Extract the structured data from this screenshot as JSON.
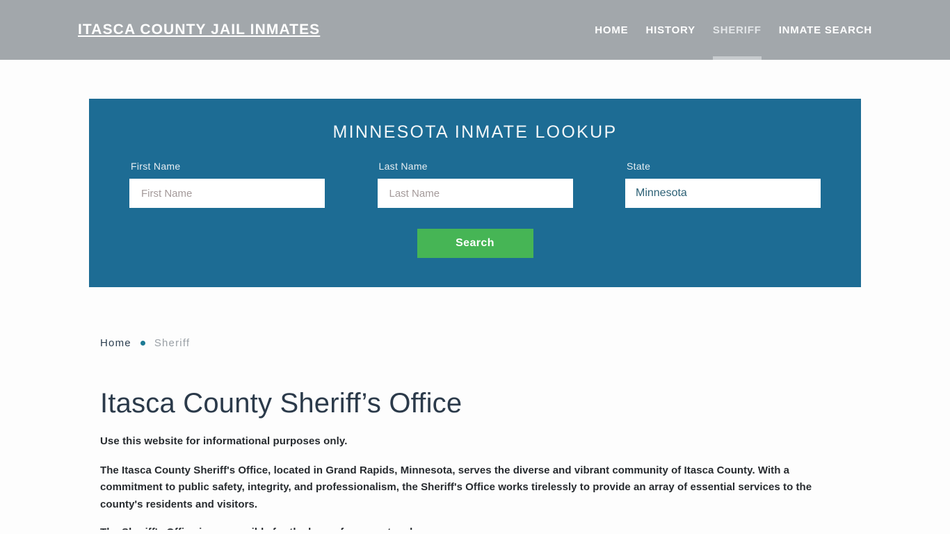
{
  "header": {
    "brand": "ITASCA COUNTY JAIL INMATES",
    "nav": [
      {
        "label": "HOME",
        "active": false
      },
      {
        "label": "HISTORY",
        "active": false
      },
      {
        "label": "SHERIFF",
        "active": true
      },
      {
        "label": "INMATE SEARCH",
        "active": false
      }
    ]
  },
  "lookup": {
    "title": "MINNESOTA INMATE LOOKUP",
    "first_name": {
      "label": "First Name",
      "placeholder": "First Name",
      "value": ""
    },
    "last_name": {
      "label": "Last Name",
      "placeholder": "Last Name",
      "value": ""
    },
    "state": {
      "label": "State",
      "selected": "Minnesota"
    },
    "search_label": "Search"
  },
  "breadcrumb": {
    "home": "Home",
    "current": "Sheriff"
  },
  "main": {
    "title": "Itasca County Sheriff’s Office",
    "lede": "Use this website for informational purposes only.",
    "paragraph": "The Itasca County Sheriff's Office, located in Grand Rapids, Minnesota, serves the diverse and vibrant community of Itasca County. With a commitment to public safety, integrity, and professionalism, the Sheriff's Office works tirelessly to provide an array of essential services to the county's residents and visitors.",
    "paragraph_clipped": "The Sheriff's Office is responsible for the law enforcement and"
  },
  "colors": {
    "header_bg": "#a2a7ab",
    "panel_bg": "#1d6c94",
    "accent_green": "#46b555",
    "page_bg": "#fdfdfd",
    "title_text": "#2b3a4a",
    "crumb_dot": "#1d7a94"
  }
}
